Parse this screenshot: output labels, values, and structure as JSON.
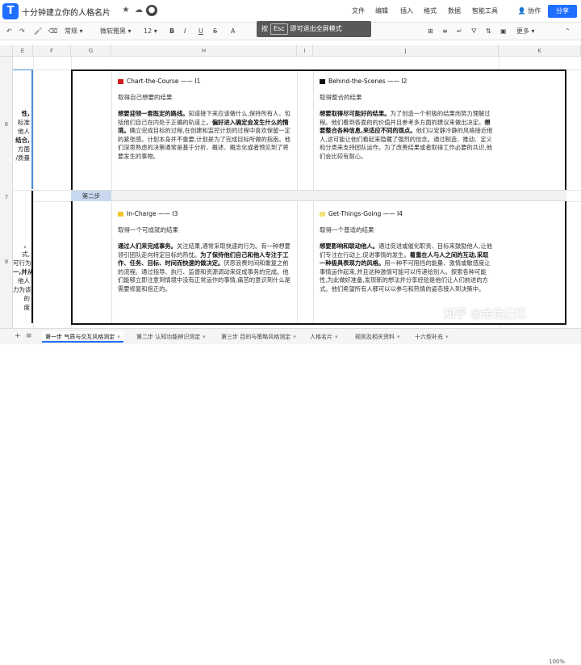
{
  "app": {
    "title": "十分钟建立你的人格名片"
  },
  "menu": {
    "items": [
      "文件",
      "编辑",
      "插入",
      "格式",
      "数据",
      "智能工具"
    ],
    "collab": "协作",
    "share": "分享"
  },
  "toolbar": {
    "format": "常规",
    "font": "微软雅黑",
    "size": "12",
    "more": "更多"
  },
  "hint": {
    "press": "按",
    "key": "Esc",
    "text": "即可退出全屏模式"
  },
  "columns": [
    "E",
    "F",
    "G",
    "H",
    "I",
    "J",
    "K"
  ],
  "rows": [
    "6",
    "7",
    "8"
  ],
  "left": {
    "top": [
      "性,",
      "标准",
      "他人",
      "结合,",
      "方面",
      "/质量"
    ],
    "bottom": [
      "。",
      "式,",
      "可行为",
      "一,并从",
      "他人",
      "力为该",
      "的",
      "度"
    ]
  },
  "section": {
    "step2": "第二步"
  },
  "quads": [
    {
      "title": "Chart-the-Course —— I1",
      "subtitle": "取得自己想要的结果",
      "bold": "想要迎领一套既定的路线。",
      "body": "知道接下来应该做什么,保持所有人、包括他们自己在内处于正确的轨道上。",
      "bold2": "偏好进入确定会发生什么的情境。",
      "body2": "确立完成目标的过程,在创建和监控计划的过程中喜欢保留一定的紧张感。计划本身并不重要,计划是为了完成目标所做的指南。他们深思熟虑的决策通常是基于分析、概述、概念化或者预见到了将要发生的事物。",
      "color": "#d01c1c"
    },
    {
      "title": "Behind-the-Scenes —— I2",
      "subtitle": "取得整合的结果",
      "bold": "想要取得尽可能好的结果。",
      "body": "为了创造一个积极的结果而努力理解过程。他们看到各面的的价值并且参考多方面的建议来做出决定。",
      "bold2": "想要整合各种信息,来适应不同的观点。",
      "body2": "他们以安静冷静的风格接近他人,这可能让他们看起来隐藏了强烈的信念。通过制造、推动、定义和分类来支持团队运作。为了改善结果或者取得工作必要的共识,他们会比较有耐心。",
      "color": "#111111"
    },
    {
      "title": "In-Charge —— I3",
      "subtitle": "取得一个可成就的结果",
      "bold": "通过人们来完成事务。",
      "body": "关注结果,通常采取快速的行为。有一种想要领引团队走向特定目标的热忱。",
      "bold2": "为了保持他们自己和他人专注于工作、任务、目标、时间而快速的做决定。",
      "body2": "厌恶浪费时间和重复之前的流程。通过指导、执行、监督和资源调动来促成事务的完成。他们能够立即注意到情境中没有正常运作的事情,痛苦的意识到什么是需要修复和指正的。",
      "color": "#f2c42c"
    },
    {
      "title": "Get-Things-Going —— I4",
      "subtitle": "取得一个普适的结果",
      "bold": "想要影响和联动他人。",
      "body": "通过促进或催化职责、目标来鼓励他人,让他们专注在行动上,促进事情的发生。",
      "bold2": "着重在人与人之间的互动,采取一种极具表现力的风格。",
      "body2": "用一种不可阻挡的能量、激情或敏感度让事情运作起来,并且这种激情可能可以传递给别人。探索各种可能性,为此做好准备,发现新的想法并分享经验是他们让人们前进的方式。他们希望所有人都可以以参与和热情的姿态接入到决策中。",
      "color": "#f5e27a"
    }
  ],
  "tabs": [
    "第一步 气质与交互风格测定",
    "第二步 认知功能辨识测定",
    "第三步 目的与策略风格测定",
    "人格名片",
    "规则及相关资料",
    "十六型补充"
  ],
  "zoom": "100%",
  "watermark": "知乎 @金色魔王"
}
